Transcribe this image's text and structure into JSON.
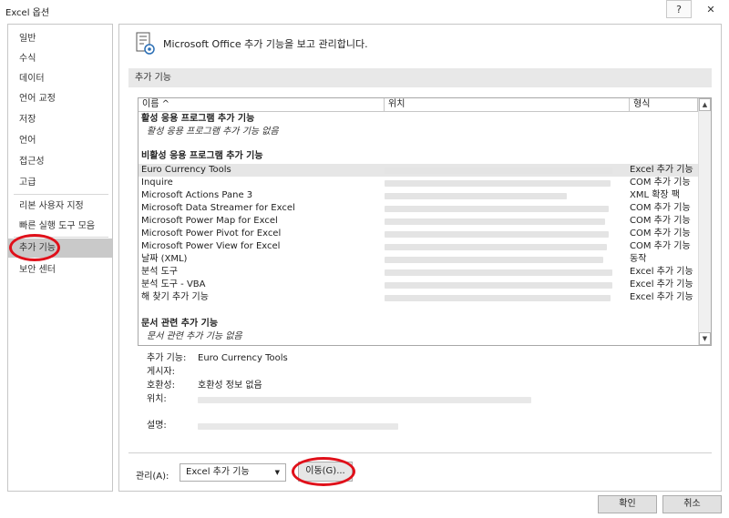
{
  "window": {
    "title": "Excel 옵션",
    "help_glyph": "?",
    "close_glyph": "✕"
  },
  "sidebar": {
    "items": [
      {
        "label": "일반"
      },
      {
        "label": "수식"
      },
      {
        "label": "데이터"
      },
      {
        "label": "언어 교정"
      },
      {
        "label": "저장"
      },
      {
        "label": "언어"
      },
      {
        "label": "접근성"
      },
      {
        "label": "고급"
      },
      {
        "label": "리본 사용자 지정"
      },
      {
        "label": "빠른 실행 도구 모음"
      },
      {
        "label": "추가 기능",
        "active": true
      },
      {
        "label": "보안 센터"
      }
    ]
  },
  "main": {
    "header": "Microsoft Office 추가 기능을 보고 관리합니다.",
    "section_title": "추가 기능",
    "columns": {
      "name": "이름 ^",
      "location": "위치",
      "type": "형식"
    },
    "groups": {
      "active_title": "활성 응용 프로그램 추가 기능",
      "active_empty": "활성 응용 프로그램 추가 기능 없음",
      "inactive_title": "비활성 응용 프로그램 추가 기능",
      "document_title": "문서 관련 추가 기능",
      "document_empty": "문서 관련 추가 기능 없음"
    },
    "rows": [
      {
        "name": "Euro Currency Tools",
        "type": "Excel 추가 기능",
        "selected": true
      },
      {
        "name": "Inquire",
        "type": "COM 추가 기능"
      },
      {
        "name": "Microsoft Actions Pane 3",
        "type": "XML 확장 팩"
      },
      {
        "name": "Microsoft Data Streamer for Excel",
        "type": "COM 추가 기능"
      },
      {
        "name": "Microsoft Power Map for Excel",
        "type": "COM 추가 기능"
      },
      {
        "name": "Microsoft Power Pivot for Excel",
        "type": "COM 추가 기능"
      },
      {
        "name": "Microsoft Power View for Excel",
        "type": "COM 추가 기능"
      },
      {
        "name": "날짜 (XML)",
        "type": "동작"
      },
      {
        "name": "분석 도구",
        "type": "Excel 추가 기능"
      },
      {
        "name": "분석 도구 - VBA",
        "type": "Excel 추가 기능"
      },
      {
        "name": "해 찾기 추가 기능",
        "type": "Excel 추가 기능"
      }
    ],
    "details": {
      "addin_label": "추가 기능:",
      "addin_value": "Euro Currency Tools",
      "publisher_label": "게시자:",
      "compat_label": "호환성:",
      "compat_value": "호환성 정보 없음",
      "location_label": "위치:",
      "description_label": "설명:"
    },
    "manage": {
      "label": "관리(A):",
      "selected": "Excel 추가 기능",
      "go_label": "이동(G)..."
    }
  },
  "footer": {
    "ok_label": "확인",
    "cancel_label": "취소"
  },
  "colors": {
    "highlight_circle": "#e0101a",
    "active_nav": "#c9c9c9"
  }
}
